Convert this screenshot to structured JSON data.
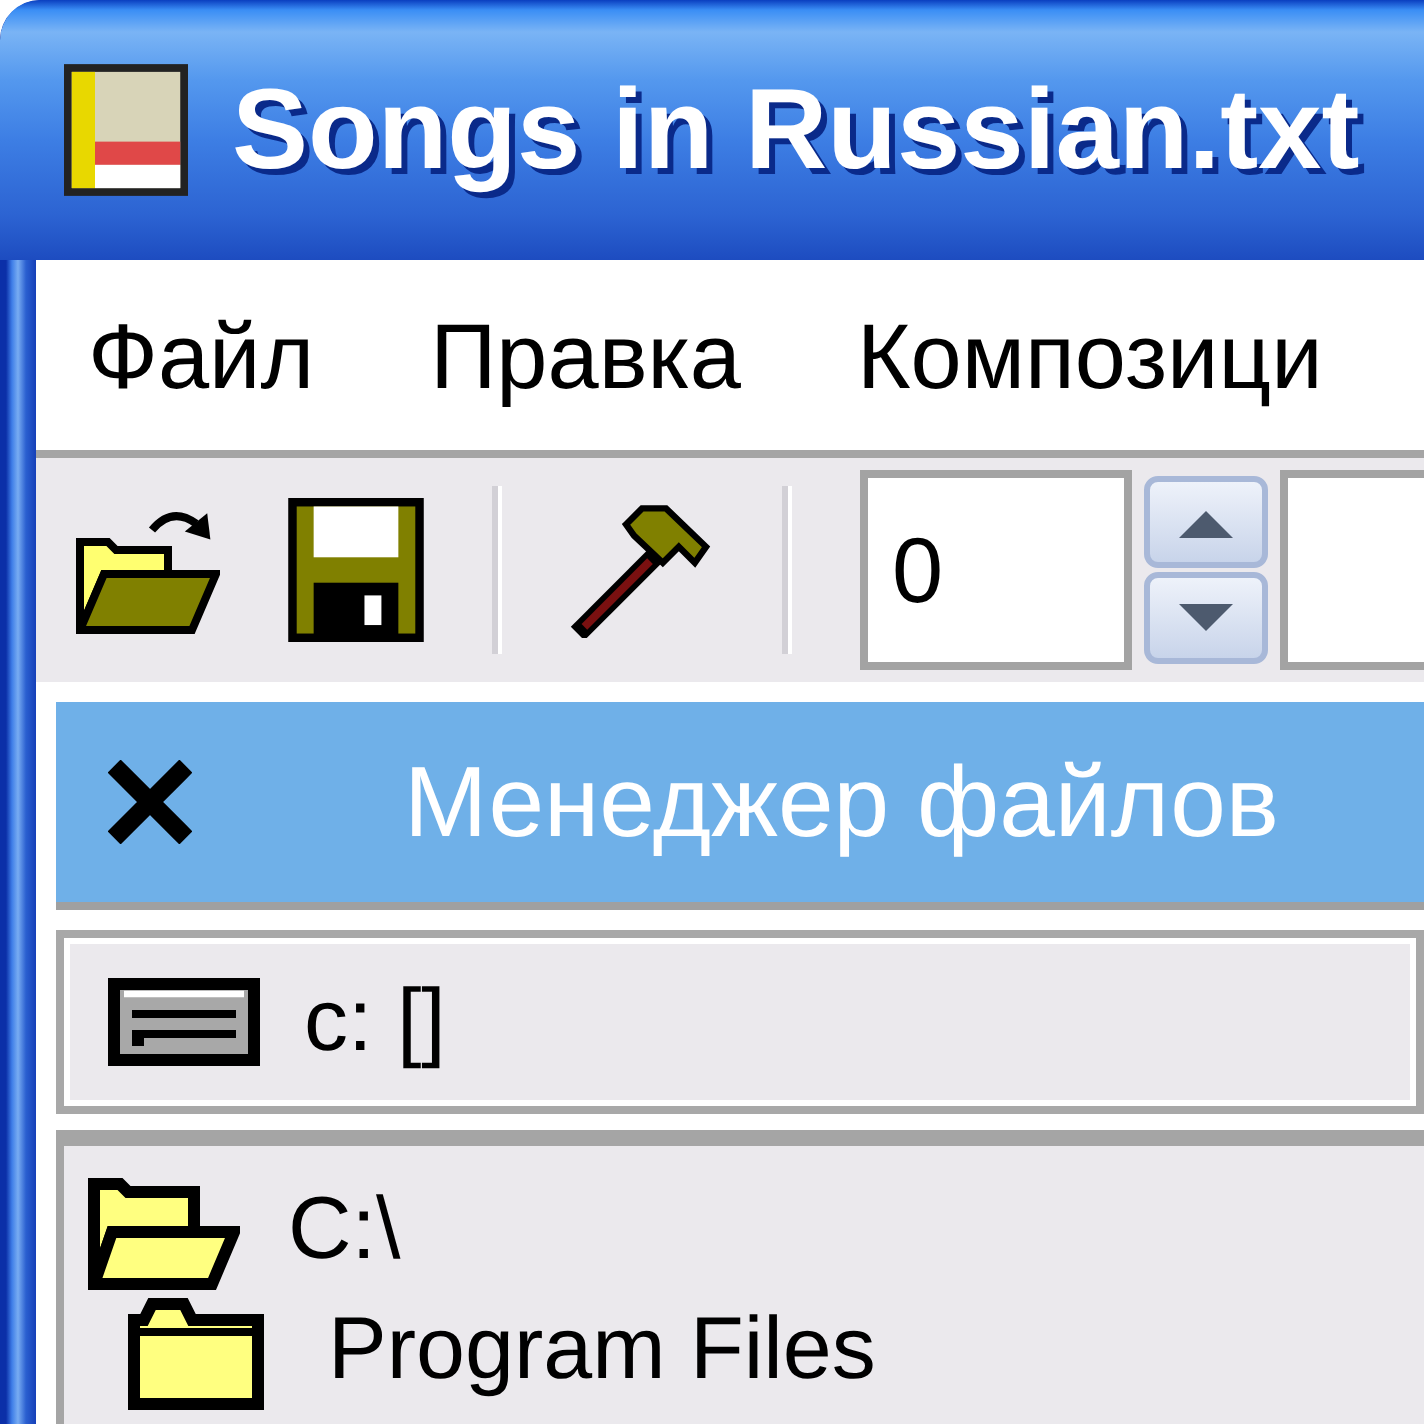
{
  "window": {
    "title": "Songs in Russian.txt"
  },
  "menu_bar": {
    "items": [
      "Файл",
      "Правка",
      "Композици"
    ]
  },
  "toolbar": {
    "number_field": {
      "value": "0"
    }
  },
  "file_manager": {
    "title": "Менеджер файлов",
    "drive_selector": {
      "value": "c: []"
    },
    "tree": [
      {
        "label": "C:\\",
        "expanded": true,
        "children": [
          {
            "label": "Program Files",
            "expanded": false
          }
        ]
      }
    ]
  }
}
